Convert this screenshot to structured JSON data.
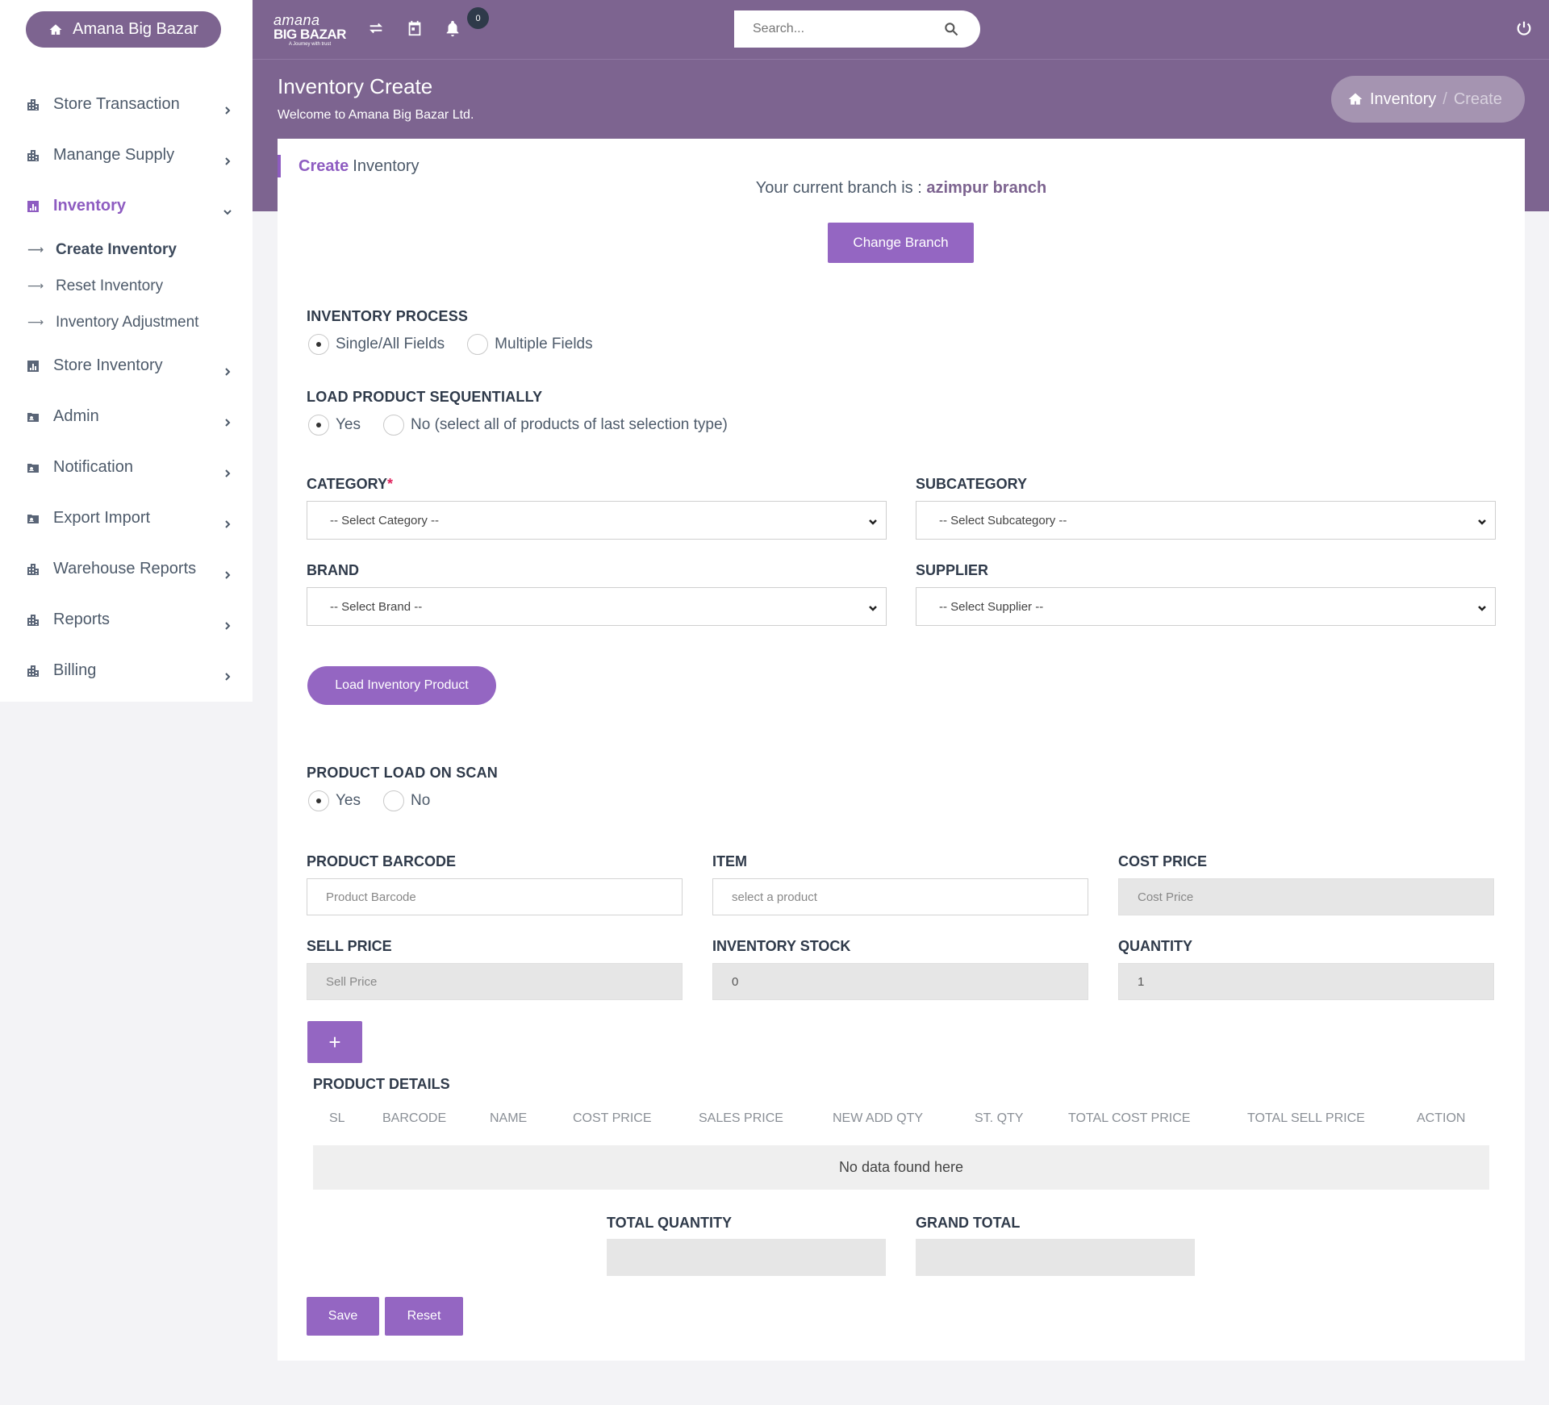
{
  "sidebar": {
    "brand_label": "Amana Big Bazar",
    "items": [
      {
        "label": "Store Transaction",
        "icon": "building-icon"
      },
      {
        "label": "Manange Supply",
        "icon": "building-icon"
      },
      {
        "label": "Inventory",
        "icon": "chart-icon",
        "active": true
      },
      {
        "label": "Store Inventory",
        "icon": "chart-icon"
      },
      {
        "label": "Admin",
        "icon": "id-card-icon"
      },
      {
        "label": "Notification",
        "icon": "id-card-icon"
      },
      {
        "label": "Export Import",
        "icon": "id-card-icon"
      },
      {
        "label": "Warehouse Reports",
        "icon": "building-icon"
      },
      {
        "label": "Reports",
        "icon": "building-icon"
      },
      {
        "label": "Billing",
        "icon": "building-icon"
      }
    ],
    "sub_items": [
      "Create Inventory",
      "Reset Inventory",
      "Inventory Adjustment"
    ]
  },
  "topbar": {
    "logo_line1": "amana",
    "logo_line2": "BIG BAZAR",
    "logo_tagline": "A Journey with trust",
    "notification_count": "0",
    "search_placeholder": "Search..."
  },
  "header": {
    "title": "Inventory Create",
    "subtitle": "Welcome to Amana Big Bazar Ltd.",
    "breadcrumb_home": "Inventory",
    "breadcrumb_sep": "/",
    "breadcrumb_current": "Create"
  },
  "card": {
    "title_highlight": "Create",
    "title_rest": "Inventory",
    "branch_prefix": "Your current branch is :",
    "branch_name": "azimpur branch",
    "change_branch_label": "Change Branch"
  },
  "inventory_process": {
    "label": "INVENTORY PROCESS",
    "options": [
      "Single/All Fields",
      "Multiple Fields"
    ],
    "selected": 0
  },
  "load_sequential": {
    "label": "LOAD PRODUCT SEQUENTIALLY",
    "options": [
      "Yes",
      "No (select all of products of last selection type)"
    ],
    "selected": 0
  },
  "filters": {
    "category_label": "CATEGORY",
    "category_required": "*",
    "category_value": "-- Select Category --",
    "subcategory_label": "SUBCATEGORY",
    "subcategory_value": "-- Select Subcategory --",
    "brand_label": "BRAND",
    "brand_value": "-- Select Brand --",
    "supplier_label": "SUPPLIER",
    "supplier_value": "-- Select Supplier --"
  },
  "load_button_label": "Load Inventory Product",
  "scan": {
    "label": "PRODUCT LOAD ON SCAN",
    "options": [
      "Yes",
      "No"
    ],
    "selected": 0
  },
  "product_fields": {
    "barcode_label": "PRODUCT BARCODE",
    "barcode_placeholder": "Product Barcode",
    "item_label": "ITEM",
    "item_placeholder": "select a product",
    "cost_label": "COST PRICE",
    "cost_placeholder": "Cost Price",
    "sell_label": "SELL PRICE",
    "sell_placeholder": "Sell Price",
    "stock_label": "INVENTORY STOCK",
    "stock_value": "0",
    "qty_label": "QUANTITY",
    "qty_value": "1"
  },
  "plus_label": "+",
  "product_details": {
    "title": "PRODUCT DETAILS",
    "columns": [
      "SL",
      "BARCODE",
      "NAME",
      "COST PRICE",
      "SALES PRICE",
      "NEW ADD QTY",
      "ST. QTY",
      "TOTAL COST PRICE",
      "TOTAL SELL PRICE",
      "ACTION"
    ],
    "empty_text": "No data found here"
  },
  "totals": {
    "quantity_label": "TOTAL QUANTITY",
    "grand_label": "GRAND TOTAL"
  },
  "actions": {
    "save_label": "Save",
    "reset_label": "Reset"
  },
  "colors": {
    "brand": "#7d6490",
    "accent": "#9466c2",
    "active_nav": "#8e5cc1"
  }
}
